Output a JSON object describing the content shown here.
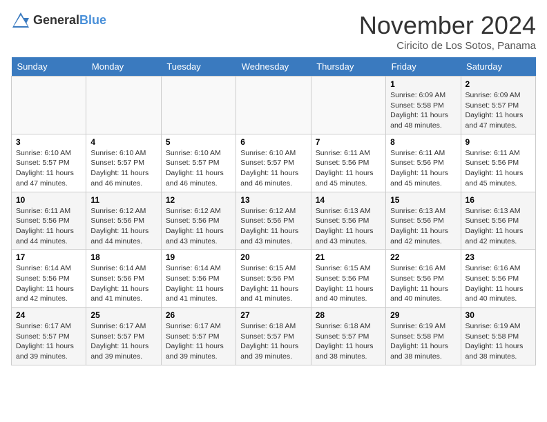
{
  "logo": {
    "general": "General",
    "blue": "Blue"
  },
  "title": "November 2024",
  "subtitle": "Ciricito de Los Sotos, Panama",
  "days_header": [
    "Sunday",
    "Monday",
    "Tuesday",
    "Wednesday",
    "Thursday",
    "Friday",
    "Saturday"
  ],
  "weeks": [
    [
      {
        "day": "",
        "info": ""
      },
      {
        "day": "",
        "info": ""
      },
      {
        "day": "",
        "info": ""
      },
      {
        "day": "",
        "info": ""
      },
      {
        "day": "",
        "info": ""
      },
      {
        "day": "1",
        "info": "Sunrise: 6:09 AM\nSunset: 5:58 PM\nDaylight: 11 hours\nand 48 minutes."
      },
      {
        "day": "2",
        "info": "Sunrise: 6:09 AM\nSunset: 5:57 PM\nDaylight: 11 hours\nand 47 minutes."
      }
    ],
    [
      {
        "day": "3",
        "info": "Sunrise: 6:10 AM\nSunset: 5:57 PM\nDaylight: 11 hours\nand 47 minutes."
      },
      {
        "day": "4",
        "info": "Sunrise: 6:10 AM\nSunset: 5:57 PM\nDaylight: 11 hours\nand 46 minutes."
      },
      {
        "day": "5",
        "info": "Sunrise: 6:10 AM\nSunset: 5:57 PM\nDaylight: 11 hours\nand 46 minutes."
      },
      {
        "day": "6",
        "info": "Sunrise: 6:10 AM\nSunset: 5:57 PM\nDaylight: 11 hours\nand 46 minutes."
      },
      {
        "day": "7",
        "info": "Sunrise: 6:11 AM\nSunset: 5:56 PM\nDaylight: 11 hours\nand 45 minutes."
      },
      {
        "day": "8",
        "info": "Sunrise: 6:11 AM\nSunset: 5:56 PM\nDaylight: 11 hours\nand 45 minutes."
      },
      {
        "day": "9",
        "info": "Sunrise: 6:11 AM\nSunset: 5:56 PM\nDaylight: 11 hours\nand 45 minutes."
      }
    ],
    [
      {
        "day": "10",
        "info": "Sunrise: 6:11 AM\nSunset: 5:56 PM\nDaylight: 11 hours\nand 44 minutes."
      },
      {
        "day": "11",
        "info": "Sunrise: 6:12 AM\nSunset: 5:56 PM\nDaylight: 11 hours\nand 44 minutes."
      },
      {
        "day": "12",
        "info": "Sunrise: 6:12 AM\nSunset: 5:56 PM\nDaylight: 11 hours\nand 43 minutes."
      },
      {
        "day": "13",
        "info": "Sunrise: 6:12 AM\nSunset: 5:56 PM\nDaylight: 11 hours\nand 43 minutes."
      },
      {
        "day": "14",
        "info": "Sunrise: 6:13 AM\nSunset: 5:56 PM\nDaylight: 11 hours\nand 43 minutes."
      },
      {
        "day": "15",
        "info": "Sunrise: 6:13 AM\nSunset: 5:56 PM\nDaylight: 11 hours\nand 42 minutes."
      },
      {
        "day": "16",
        "info": "Sunrise: 6:13 AM\nSunset: 5:56 PM\nDaylight: 11 hours\nand 42 minutes."
      }
    ],
    [
      {
        "day": "17",
        "info": "Sunrise: 6:14 AM\nSunset: 5:56 PM\nDaylight: 11 hours\nand 42 minutes."
      },
      {
        "day": "18",
        "info": "Sunrise: 6:14 AM\nSunset: 5:56 PM\nDaylight: 11 hours\nand 41 minutes."
      },
      {
        "day": "19",
        "info": "Sunrise: 6:14 AM\nSunset: 5:56 PM\nDaylight: 11 hours\nand 41 minutes."
      },
      {
        "day": "20",
        "info": "Sunrise: 6:15 AM\nSunset: 5:56 PM\nDaylight: 11 hours\nand 41 minutes."
      },
      {
        "day": "21",
        "info": "Sunrise: 6:15 AM\nSunset: 5:56 PM\nDaylight: 11 hours\nand 40 minutes."
      },
      {
        "day": "22",
        "info": "Sunrise: 6:16 AM\nSunset: 5:56 PM\nDaylight: 11 hours\nand 40 minutes."
      },
      {
        "day": "23",
        "info": "Sunrise: 6:16 AM\nSunset: 5:56 PM\nDaylight: 11 hours\nand 40 minutes."
      }
    ],
    [
      {
        "day": "24",
        "info": "Sunrise: 6:17 AM\nSunset: 5:57 PM\nDaylight: 11 hours\nand 39 minutes."
      },
      {
        "day": "25",
        "info": "Sunrise: 6:17 AM\nSunset: 5:57 PM\nDaylight: 11 hours\nand 39 minutes."
      },
      {
        "day": "26",
        "info": "Sunrise: 6:17 AM\nSunset: 5:57 PM\nDaylight: 11 hours\nand 39 minutes."
      },
      {
        "day": "27",
        "info": "Sunrise: 6:18 AM\nSunset: 5:57 PM\nDaylight: 11 hours\nand 39 minutes."
      },
      {
        "day": "28",
        "info": "Sunrise: 6:18 AM\nSunset: 5:57 PM\nDaylight: 11 hours\nand 38 minutes."
      },
      {
        "day": "29",
        "info": "Sunrise: 6:19 AM\nSunset: 5:58 PM\nDaylight: 11 hours\nand 38 minutes."
      },
      {
        "day": "30",
        "info": "Sunrise: 6:19 AM\nSunset: 5:58 PM\nDaylight: 11 hours\nand 38 minutes."
      }
    ]
  ]
}
